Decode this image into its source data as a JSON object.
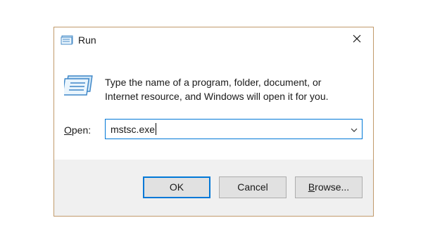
{
  "window": {
    "title": "Run",
    "title_icon": "run-icon",
    "close_icon": "close-icon"
  },
  "main": {
    "description_line1": "Type the name of a program, folder, document, or",
    "description_line2": "Internet resource, and Windows will open it for you.",
    "big_icon": "run-icon"
  },
  "open_field": {
    "label_mnemonic": "O",
    "label_rest": "pen:",
    "value": "mstsc.exe",
    "dropdown_icon": "chevron-down-icon"
  },
  "buttons": {
    "ok": "OK",
    "cancel": "Cancel",
    "browse_mnemonic": "B",
    "browse_rest": "rowse..."
  },
  "colors": {
    "accent": "#0078d7",
    "window_border": "#c19a6b",
    "footer_bg": "#f0f0f0",
    "button_bg": "#e1e1e1"
  }
}
